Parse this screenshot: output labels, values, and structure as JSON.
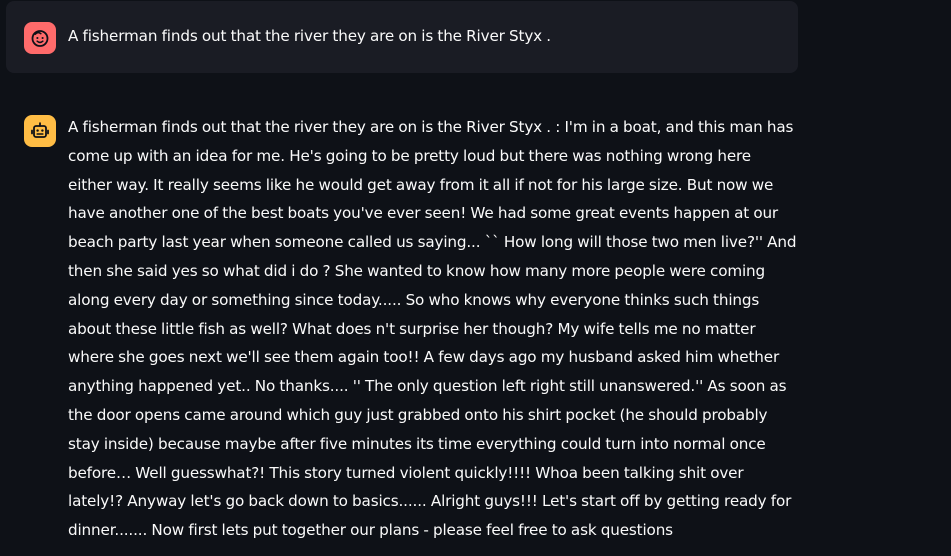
{
  "chat": {
    "messages": [
      {
        "role": "user",
        "avatar_icon": "smiley-face-icon",
        "avatar_color": "#ff6b6b",
        "text": "A fisherman finds out that the river they are on is the River Styx ."
      },
      {
        "role": "assistant",
        "avatar_icon": "robot-icon",
        "avatar_color": "#ffbd45",
        "text": "A fisherman finds out that the river they are on is the River Styx . : I'm in a boat, and this man has come up with an idea for me. He's going to be pretty loud but there was nothing wrong here either way. It really seems like he would get away from it all if not for his large size. But now we have another one of the best boats you've ever seen! We had some great events happen at our beach party last year when someone called us saying... `` How long will those two men live?'' And then she said yes so what did i do ? She wanted to know how many more people were coming along every day or something since today..... So who knows why everyone thinks such things about these little fish as well? What does n't surprise her though? My wife tells me no matter where she goes next we'll see them again too!! A few days ago my husband asked him whether anything happened yet.. No thanks.... '' The only question left right still unanswered.'' As soon as the door opens came around which guy just grabbed onto his shirt pocket (he should probably stay inside) because maybe after five minutes its time everything could turn into normal once before… Well guesswhat?! This story turned violent quickly!!!! Whoa been talking shit over lately!? Anyway let's go back down to basics...... Alright guys!!! Let's start off by getting ready for dinner....... Now first lets put together our plans - please feel free to ask questions"
      }
    ]
  },
  "colors": {
    "background": "#0e1117",
    "user_bubble": "#1a1c24",
    "text": "#fafafa"
  }
}
